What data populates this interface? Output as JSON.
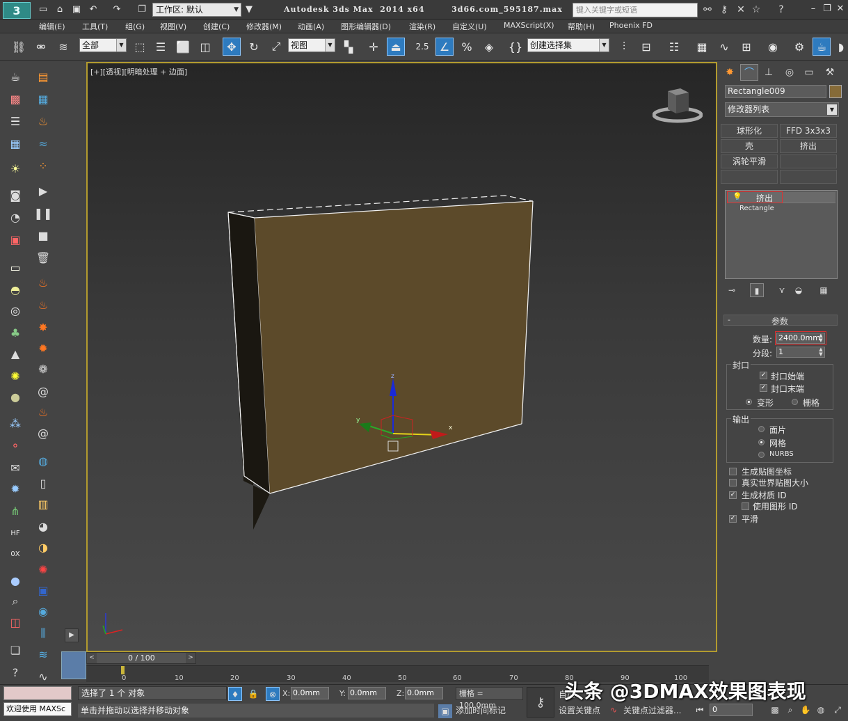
{
  "titlebar": {
    "app_logo": "3",
    "workspace_label": "工作区: 默认",
    "app_title": "Autodesk 3ds Max  2014 x64",
    "file_name": "3d66.com_595187.max",
    "search_placeholder": "键入关键字或短语",
    "quick_access_icons": [
      "new-file-icon",
      "open-file-icon",
      "save-icon",
      "undo-icon",
      "redo-icon",
      "project-folder-icon"
    ],
    "right_icons": [
      "binoculars-icon",
      "key-tools-icon",
      "exchange-icon",
      "star-icon",
      "help-icon"
    ],
    "window_controls": [
      "minimize-icon",
      "restore-icon",
      "close-icon"
    ]
  },
  "menubar": {
    "items": [
      "编辑(E)",
      "工具(T)",
      "组(G)",
      "视图(V)",
      "创建(C)",
      "修改器(M)",
      "动画(A)",
      "图形编辑器(D)",
      "渲染(R)",
      "自定义(U)",
      "MAXScript(X)",
      "帮助(H)",
      "Phoenix FD"
    ]
  },
  "toolbar": {
    "selection_filter": "全部",
    "reference_coord": "视图",
    "snap_value": "2.5",
    "named_selection": "创建选择集"
  },
  "viewport": {
    "label": "[+][透视][明暗处理 + 边面]",
    "gizmo_axes": [
      "x",
      "y",
      "z"
    ]
  },
  "command_panel": {
    "tabs": [
      "create-tab-icon",
      "modify-tab-icon",
      "hierarchy-tab-icon",
      "motion-tab-icon",
      "display-tab-icon",
      "utilities-tab-icon"
    ],
    "object_name": "Rectangle009",
    "object_color": "#866b38",
    "modifier_list": "修改器列表",
    "modifier_buttons": [
      "球形化",
      "FFD 3x3x3",
      "壳",
      "挤出",
      "涡轮平滑",
      ""
    ],
    "stack": [
      "挤出",
      "Rectangle"
    ],
    "params": {
      "rollout_title": "参数",
      "amount_label": "数量:",
      "amount_value": "2400.0mm",
      "segments_label": "分段:",
      "segments_value": "1",
      "capping_title": "封口",
      "cap_start": "封口始端",
      "cap_end": "封口末端",
      "morph": "变形",
      "grid": "栅格",
      "output_title": "输出",
      "patch": "面片",
      "mesh": "网格",
      "nurbs": "NURBS",
      "gen_map_coords": "生成贴图坐标",
      "real_world_map": "真实世界贴图大小",
      "gen_mat_ids": "生成材质 ID",
      "use_shape_ids": "使用图形 ID",
      "smooth": "平滑"
    }
  },
  "timeline": {
    "slider_value": "0 / 100",
    "ticks": [
      "0",
      "10",
      "20",
      "30",
      "40",
      "50",
      "60",
      "70",
      "80",
      "90",
      "100"
    ]
  },
  "statusbar": {
    "maxscript_welcome": "欢迎使用 MAXSc",
    "selection_status": "选择了 1 个 对象",
    "prompt": "单击并拖动以选择并移动对象",
    "x_label": "X:",
    "x_value": "0.0mm",
    "y_label": "Y:",
    "y_value": "0.0mm",
    "z_label": "Z:",
    "z_value": "0.0mm",
    "grid": "栅格 = 100.0mm",
    "add_time_tag": "添加时间标记",
    "auto_key": "自动",
    "set_key": "设置关键点",
    "key_filters": "关键点过滤器...",
    "frame": "0"
  },
  "watermark": "头条 @3DMAX效果图表现"
}
